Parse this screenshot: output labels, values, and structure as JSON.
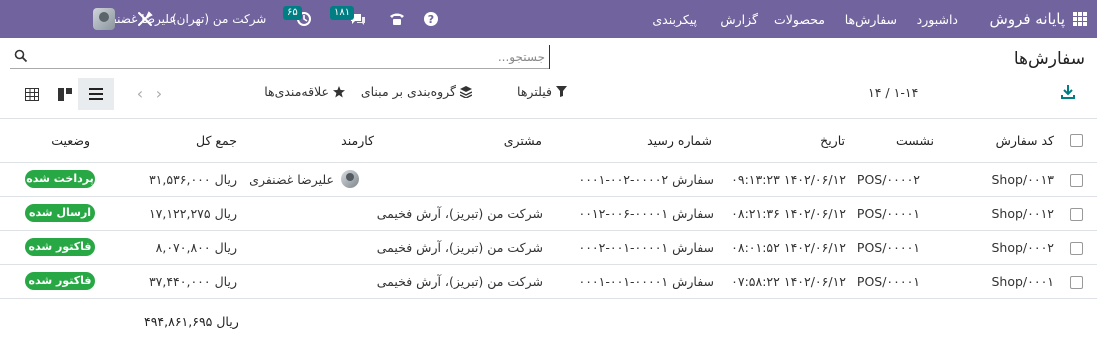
{
  "navbar": {
    "brand": "پایانه فروش",
    "menu": [
      "داشبورد",
      "سفارش‌ها",
      "محصولات",
      "گزارش",
      "پیکربندی"
    ],
    "company": "شرکت من (تهران)",
    "activity_count": "۶۵",
    "messages_count": "۱۸۱",
    "user_name": "علیرضا غضنفری",
    "bg_color": "#71639e"
  },
  "control": {
    "title": "سفارش‌ها",
    "search_placeholder": "جستجو...",
    "filters_label": "فیلترها",
    "groupby_label": "گروه‌بندی بر مبنای",
    "favorites_label": "علاقه‌مندی‌ها",
    "pager_value": "۱-۱۴",
    "pager_sep": "/",
    "pager_total": "۱۴"
  },
  "table": {
    "columns": [
      "کد سفارش",
      "نشست",
      "تاریخ",
      "شماره رسید",
      "مشتری",
      "کارمند",
      "جمع کل",
      "وضعیت"
    ],
    "rows": [
      {
        "order": "Shop/۰۰۱۳",
        "session": "POS/۰۰۰۰۲",
        "date": "۱۴۰۲/۰۶/۱۲ ۰۹:۱۳:۲۳",
        "receipt": "سفارش ۰۰۰۰۲-۰۰۲-۰۰۰۱",
        "customer": "",
        "employee": "علیرضا غضنفری",
        "total": "ریال ۳۱,۵۳۶,۰۰۰",
        "status": "پرداخت شده",
        "status_color": "#28a745"
      },
      {
        "order": "Shop/۰۰۱۲",
        "session": "POS/۰۰۰۰۱",
        "date": "۱۴۰۲/۰۶/۱۲ ۰۸:۲۱:۳۶",
        "receipt": "سفارش ۰۰۰۰۱-۰۰۶-۰۰۱۲",
        "customer": "شرکت من (تبریز)، آرش فخیمی",
        "employee": "",
        "total": "ریال ۱۷,۱۲۲,۲۷۵",
        "status": "ارسال شده",
        "status_color": "#28a745"
      },
      {
        "order": "Shop/۰۰۰۲",
        "session": "POS/۰۰۰۰۱",
        "date": "۱۴۰۲/۰۶/۱۲ ۰۸:۰۱:۵۲",
        "receipt": "سفارش ۰۰۰۰۱-۰۰۱-۰۰۰۲",
        "customer": "شرکت من (تبریز)، آرش فخیمی",
        "employee": "",
        "total": "ریال ۸,۰۷۰,۸۰۰",
        "status": "فاکتور شده",
        "status_color": "#28a745"
      },
      {
        "order": "Shop/۰۰۰۱",
        "session": "POS/۰۰۰۰۱",
        "date": "۱۴۰۲/۰۶/۱۲ ۰۷:۵۸:۲۲",
        "receipt": "سفارش ۰۰۰۰۱-۰۰۱-۰۰۰۱",
        "customer": "شرکت من (تبریز)، آرش فخیمی",
        "employee": "",
        "total": "ریال ۳۷,۴۴۰,۰۰۰",
        "status": "فاکتور شده",
        "status_color": "#28a745"
      }
    ],
    "grand_total": "ریال ۴۹۴,۸۶۱,۶۹۵"
  }
}
